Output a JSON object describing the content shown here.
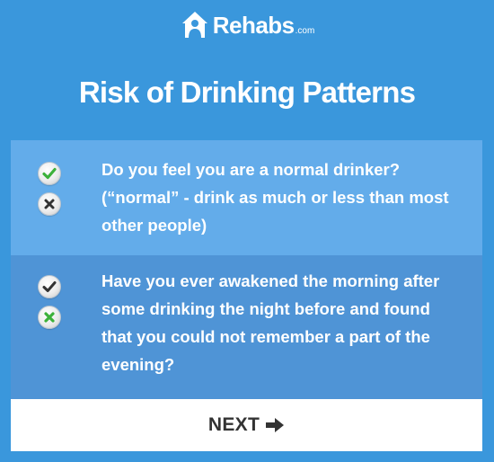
{
  "brand": {
    "name": "Rehabs",
    "suffix": ".com",
    "logo_icon": "house-person-icon"
  },
  "title": "Risk of Drinking Patterns",
  "colors": {
    "background": "#3a97dc",
    "question_1_bg": "#63acea",
    "question_2_bg": "#4f94d6",
    "check_selected": "#3cb13a",
    "x_selected": "#3cb13a",
    "unselected_mark": "#333333"
  },
  "questions": [
    {
      "text_line_1": "Do you feel you are a normal drinker?",
      "text_line_2": "(“normal” - drink as much or less than most",
      "text_line_3": "other people)",
      "yes_icon": "check-icon",
      "no_icon": "x-icon",
      "selected": "yes"
    },
    {
      "text_line_1": "Have you ever awakened the morning after",
      "text_line_2": "some drinking the night before and found",
      "text_line_3": "that you could not remember a part of the",
      "text_line_4": "evening?",
      "yes_icon": "check-icon",
      "no_icon": "x-icon",
      "selected": "no"
    }
  ],
  "next_button": {
    "label": "NEXT",
    "icon": "arrow-right-icon"
  }
}
